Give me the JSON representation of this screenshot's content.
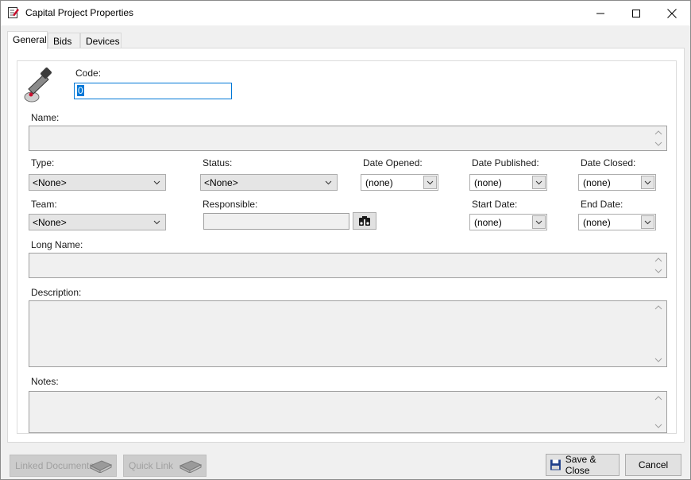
{
  "window": {
    "title": "Capital Project Properties",
    "controls": {
      "minimize": "minimize",
      "maximize": "maximize",
      "close": "close"
    }
  },
  "tabs": [
    {
      "label": "General",
      "active": true
    },
    {
      "label": "Bids",
      "active": false
    },
    {
      "label": "Devices",
      "active": false
    }
  ],
  "form": {
    "code": {
      "label": "Code:",
      "value": "0"
    },
    "name": {
      "label": "Name:",
      "value": ""
    },
    "type": {
      "label": "Type:",
      "value": "<None>"
    },
    "status": {
      "label": "Status:",
      "value": "<None>"
    },
    "date_opened": {
      "label": "Date Opened:",
      "value": "(none)"
    },
    "date_published": {
      "label": "Date Published:",
      "value": "(none)"
    },
    "date_closed": {
      "label": "Date Closed:",
      "value": "(none)"
    },
    "team": {
      "label": "Team:",
      "value": "<None>"
    },
    "responsible": {
      "label": "Responsible:",
      "value": ""
    },
    "start_date": {
      "label": "Start Date:",
      "value": "(none)"
    },
    "end_date": {
      "label": "End Date:",
      "value": "(none)"
    },
    "long_name": {
      "label": "Long Name:",
      "value": ""
    },
    "description": {
      "label": "Description:",
      "value": ""
    },
    "notes": {
      "label": "Notes:",
      "value": ""
    }
  },
  "footer": {
    "linked_documents": "Linked Documents",
    "quick_link": "Quick Link",
    "save_close": "Save & Close",
    "cancel": "Cancel"
  },
  "colors": {
    "accent": "#0078d7",
    "panel": "#ffffff",
    "chrome": "#f0f0f0",
    "disabled_text": "#a0a0a0"
  }
}
